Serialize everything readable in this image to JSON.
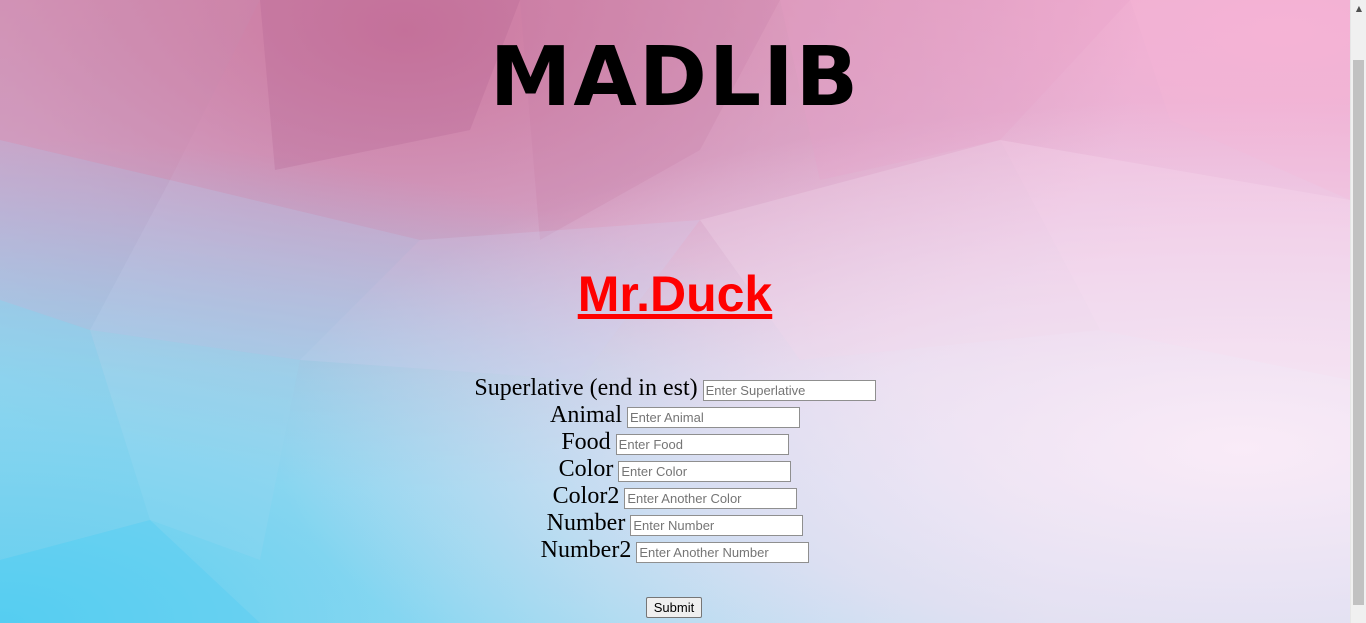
{
  "page": {
    "title": "MADLIB",
    "subtitle": "Mr.Duck"
  },
  "form": {
    "fields": [
      {
        "label": "Superlative (end in est)",
        "placeholder": "Enter Superlative"
      },
      {
        "label": "Animal",
        "placeholder": "Enter Animal"
      },
      {
        "label": "Food",
        "placeholder": "Enter Food"
      },
      {
        "label": "Color",
        "placeholder": "Enter Color"
      },
      {
        "label": "Color2",
        "placeholder": "Enter Another Color"
      },
      {
        "label": "Number",
        "placeholder": "Enter Number"
      },
      {
        "label": "Number2",
        "placeholder": "Enter Another Number"
      }
    ],
    "submit_label": "Submit"
  },
  "colors": {
    "subtitle": "#ff0000",
    "title": "#000000"
  },
  "scrollbar": {
    "up_arrow_icon": "triangle-up-icon"
  }
}
